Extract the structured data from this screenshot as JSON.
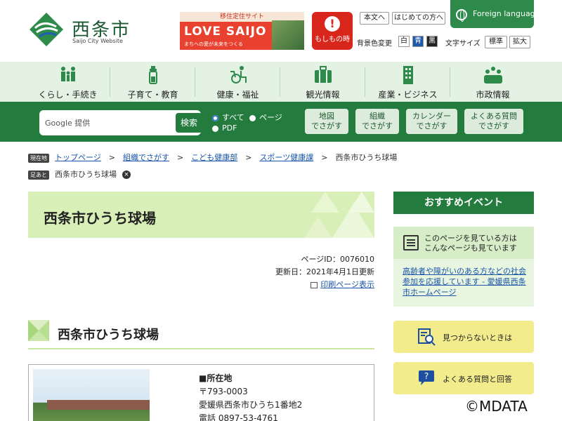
{
  "header": {
    "city_name": "西条市",
    "city_sub": "Saijo City Website",
    "banner_top": "移住定住サイト",
    "banner_main": "LOVE SAIJO",
    "banner_small": "まちへの愛が未来をつくる",
    "emergency_label": "もしもの時",
    "links": {
      "to_body": "本文へ",
      "first_time": "はじめての方へ"
    },
    "bg_color_label": "背景色変更",
    "color_buttons": [
      "白",
      "青",
      "黒"
    ],
    "text_size_label": "文字サイズ",
    "size_buttons": [
      "標準",
      "拡大"
    ],
    "foreign": "Foreign language"
  },
  "gnav": [
    {
      "label": "くらし・手続き",
      "icon": "family-icon"
    },
    {
      "label": "子育て・教育",
      "icon": "baby-bottle-icon"
    },
    {
      "label": "健康・福祉",
      "icon": "wheelchair-icon"
    },
    {
      "label": "観光情報",
      "icon": "suitcase-icon"
    },
    {
      "label": "産業・ビジネス",
      "icon": "building-icon"
    },
    {
      "label": "市政情報",
      "icon": "people-group-icon"
    }
  ],
  "search": {
    "placeholder": "Google 提供",
    "button": "検索",
    "options": [
      "すべて",
      "ページ",
      "PDF"
    ],
    "find_buttons": [
      [
        "地図",
        "でさがす"
      ],
      [
        "組織",
        "でさがす"
      ],
      [
        "カレンダー",
        "でさがす"
      ],
      [
        "よくある質問",
        "でさがす"
      ]
    ]
  },
  "breadcrumb": {
    "tag": "現在地",
    "items": [
      "トップページ",
      "組織でさがす",
      "こども健康部",
      "スポーツ健康課"
    ],
    "current": "西条市ひうち球場"
  },
  "footprint": {
    "tag": "足あと",
    "item": "西条市ひうち球場"
  },
  "page": {
    "title": "西条市ひうち球場",
    "page_id": "ページID：0076010",
    "updated": "更新日：2021年4月1日更新",
    "print": "印刷ページ表示",
    "h2": "西条市ひうち球場",
    "info": {
      "heading": "■所在地",
      "postal": "〒793-0003",
      "address": "愛媛県西条市ひうち1番地2",
      "phone": "電話 0897-53-4761"
    }
  },
  "sidebar": {
    "events_head": "おすすめイベント",
    "reco_head": [
      "このページを見ている方は",
      "こんなページも見ています"
    ],
    "reco_link": "高齢者や障がいのある方などの社会参加を応援しています - 愛媛県西条市ホームページ",
    "not_found": "見つからないときは",
    "faq": "よくある質問と回答"
  },
  "colors": {
    "green_dark": "#237b3e",
    "green_light": "#e4f2e4",
    "title_band": "#d9efb8",
    "emergency": "#d9261c",
    "yellow": "#f2ec8d"
  },
  "copyright": "©MDATA"
}
